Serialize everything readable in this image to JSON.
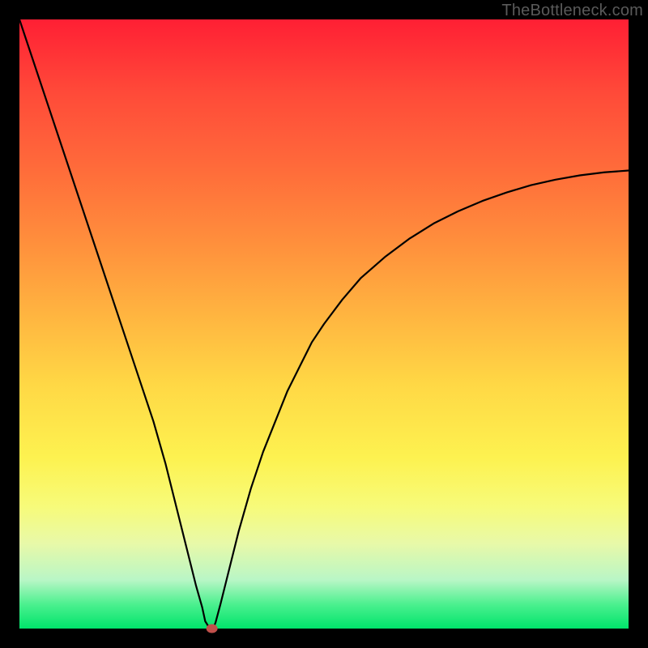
{
  "watermark": "TheBottleneck.com",
  "chart_data": {
    "type": "line",
    "title": "",
    "xlabel": "",
    "ylabel": "",
    "xlim": [
      0,
      100
    ],
    "ylim": [
      0,
      100
    ],
    "series": [
      {
        "name": "bottleneck-curve",
        "x": [
          0,
          2,
          4,
          6,
          8,
          10,
          12,
          14,
          16,
          18,
          20,
          22,
          24,
          26,
          27,
          28,
          29,
          30,
          30.5,
          31,
          31.4,
          31.8,
          32.2,
          33,
          34,
          35,
          36,
          38,
          40,
          42,
          44,
          46,
          48,
          50,
          53,
          56,
          60,
          64,
          68,
          72,
          76,
          80,
          84,
          88,
          92,
          96,
          100
        ],
        "y": [
          100,
          94,
          88,
          82,
          76,
          70,
          64,
          58,
          52,
          46,
          40,
          34,
          27,
          19,
          15,
          11,
          7,
          3.5,
          1.2,
          0.4,
          0.0,
          0.0,
          1.0,
          4,
          8,
          12,
          16,
          23,
          29,
          34,
          39,
          43,
          47,
          50,
          54,
          57.5,
          61,
          64,
          66.5,
          68.5,
          70.2,
          71.6,
          72.8,
          73.7,
          74.4,
          74.9,
          75.2
        ]
      }
    ],
    "annotations": [
      {
        "type": "point",
        "name": "minimum-marker",
        "x": 31.6,
        "y": 0.0,
        "color": "#c1504b"
      }
    ],
    "gradient_background": {
      "orientation": "vertical",
      "stops": [
        {
          "pos": 0,
          "color": "#ff1f34"
        },
        {
          "pos": 50,
          "color": "#ffb340"
        },
        {
          "pos": 75,
          "color": "#fdf250"
        },
        {
          "pos": 100,
          "color": "#00e46b"
        }
      ]
    }
  }
}
